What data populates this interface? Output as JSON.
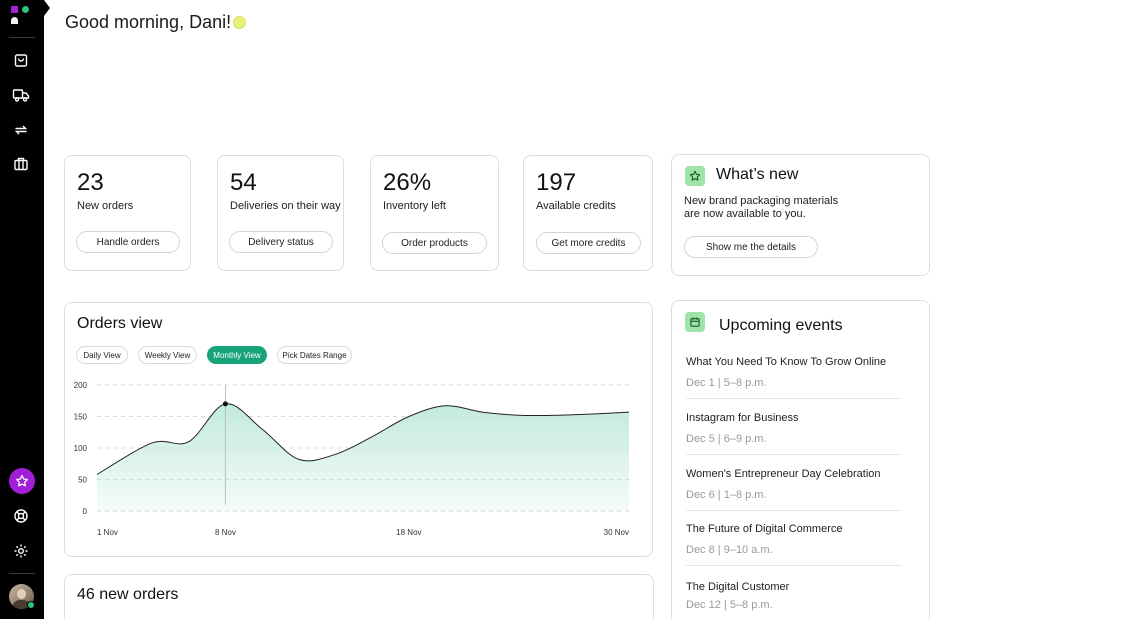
{
  "greeting": "Good morning, Dani!",
  "sidebar": {
    "items": [
      {
        "icon": "shopping-bag-icon"
      },
      {
        "icon": "truck-icon"
      },
      {
        "icon": "repeat-icon"
      },
      {
        "icon": "briefcase-icon"
      }
    ],
    "bottom": [
      {
        "icon": "star-icon"
      },
      {
        "icon": "support-icon"
      },
      {
        "icon": "gear-icon"
      }
    ],
    "accent": "#a11fd6"
  },
  "stats": [
    {
      "value": "23",
      "label": "New orders",
      "button": "Handle orders"
    },
    {
      "value": "54",
      "label": "Deliveries on their way",
      "button": "Delivery status"
    },
    {
      "value": "26%",
      "label": "Inventory left",
      "button": "Order products"
    },
    {
      "value": "197",
      "label": "Available credits",
      "button": "Get more credits"
    }
  ],
  "whats_new": {
    "title": "What’s new",
    "text_line1": "New brand packaging materials",
    "text_line2": "are now available to you.",
    "button": "Show me the details"
  },
  "orders_view": {
    "title": "Orders view",
    "tabs": [
      "Daily View",
      "Weekly View",
      "Monthly View",
      "Pick Dates Range"
    ],
    "active_tab": "Monthly View"
  },
  "chart_data": {
    "type": "area",
    "x": [
      1,
      4,
      6,
      8,
      10,
      12,
      14,
      16,
      18,
      20,
      22,
      24,
      26,
      28,
      30
    ],
    "values": [
      58,
      108,
      110,
      170,
      130,
      82,
      90,
      118,
      150,
      167,
      157,
      152,
      152,
      154,
      157
    ],
    "yticks": [
      "0",
      "50",
      "100",
      "150",
      "200"
    ],
    "xticks": [
      "1 Nov",
      "8 Nov",
      "18 Nov",
      "30 Nov"
    ],
    "xtick_days": [
      1,
      8,
      18,
      30
    ],
    "ylim": [
      0,
      200
    ],
    "xlim": [
      1,
      30
    ],
    "highlight": {
      "x": 8,
      "y": 170
    },
    "line_color": "#222222",
    "fill_color": "#bfe9d9"
  },
  "new_orders": {
    "title": "46 new orders"
  },
  "events": {
    "title": "Upcoming events",
    "items": [
      {
        "title": "What You Need To Know To Grow Online",
        "date": "Dec 1 |  5–8 p.m."
      },
      {
        "title": "Instagram for Business",
        "date": "Dec 5 | 6–9 p.m."
      },
      {
        "title": "Women's Entrepreneur Day Celebration",
        "date": "Dec 6 |  1–8 p.m."
      },
      {
        "title": "The Future of Digital Commerce",
        "date": "Dec 8 |  9–10 a.m."
      },
      {
        "title": "The Digital Customer",
        "date": "Dec 12 | 5–8 p.m."
      }
    ]
  }
}
